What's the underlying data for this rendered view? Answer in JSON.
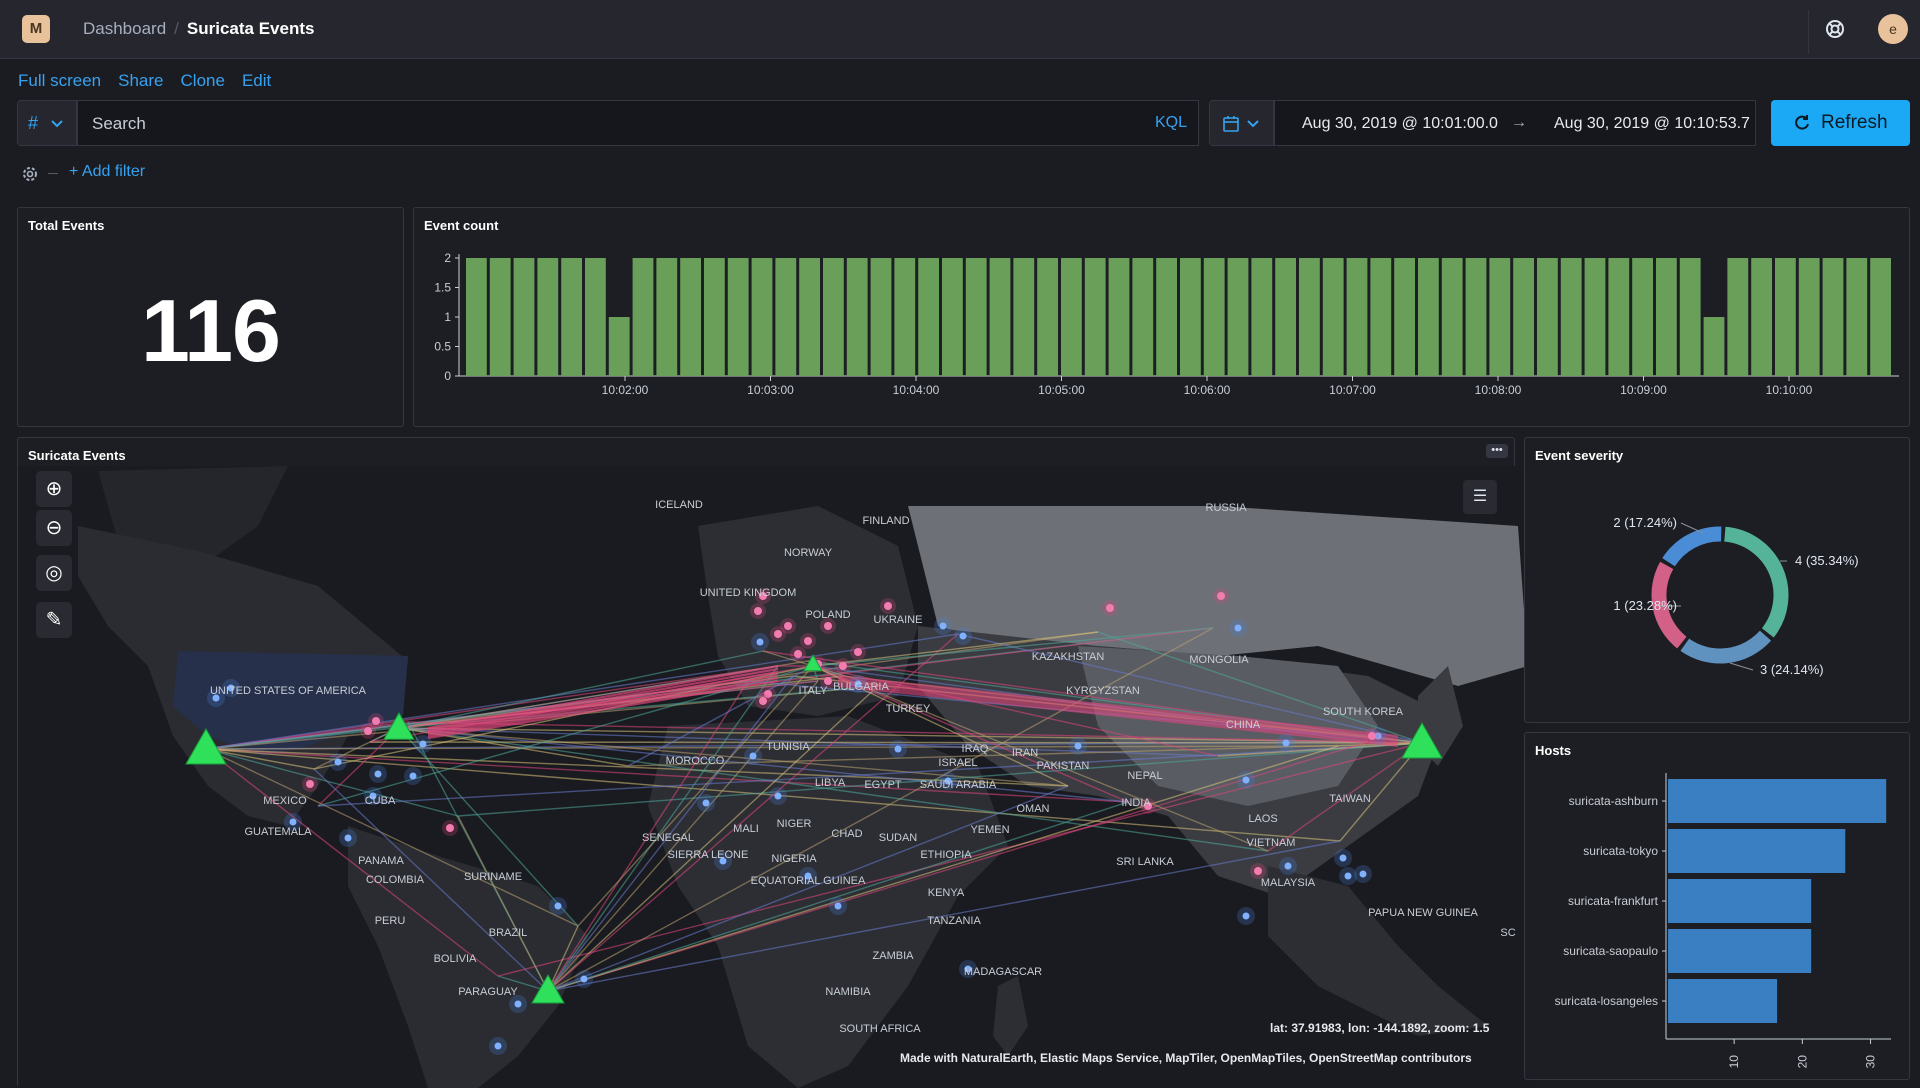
{
  "app": {
    "logo_letter": "M",
    "breadcrumbs": [
      "Dashboard",
      "Suricata Events"
    ],
    "user_initial": "e"
  },
  "actions": [
    "Full screen",
    "Share",
    "Clone",
    "Edit"
  ],
  "query": {
    "lang_symbol": "#",
    "placeholder": "Search",
    "language": "KQL",
    "time_start": "Aug 30, 2019 @ 10:01:00.0",
    "time_arrow": "→",
    "time_end": "Aug 30, 2019 @ 10:10:53.7",
    "refresh_label": "Refresh"
  },
  "filters": {
    "add_label": "+ Add filter"
  },
  "panels": {
    "total_events": {
      "title": "Total Events",
      "value": "116"
    },
    "event_count": {
      "title": "Event count"
    },
    "map": {
      "title": "Suricata Events",
      "coords": "lat: 37.91983, lon: -144.1892, zoom: 1.5",
      "attribution": "Made with NaturalEarth, Elastic Maps Service, MapTiler, OpenMapTiles, OpenStreetMap contributors",
      "labels": [
        "ICELAND",
        "FINLAND",
        "RUSSIA",
        "NORWAY",
        "UNITED KINGDOM",
        "POLAND",
        "UKRAINE",
        "KAZAKHSTAN",
        "MONGOLIA",
        "UNITED STATES OF AMERICA",
        "ITALY",
        "BULGARIA",
        "TURKEY",
        "KYRGYZSTAN",
        "SOUTH KOREA",
        "CHINA",
        "TUNISIA",
        "IRAQ",
        "IRAN",
        "MOROCCO",
        "ISRAEL",
        "PAKISTAN",
        "NEPAL",
        "LIBYA",
        "EGYPT",
        "SAUDI ARABIA",
        "TAIWAN",
        "MEXICO",
        "CUBA",
        "OMAN",
        "INDIA",
        "LAOS",
        "GUATEMALA",
        "SENEGAL",
        "MALI",
        "NIGER",
        "CHAD",
        "SUDAN",
        "YEMEN",
        "VIETNAM",
        "PANAMA",
        "SIERRA LEONE",
        "NIGERIA",
        "ETHIOPIA",
        "SRI LANKA",
        "COLOMBIA",
        "SURINAME",
        "EQUATORIAL GUINEA",
        "MALAYSIA",
        "KENYA",
        "PAPUA NEW GUINEA",
        "PERU",
        "BRAZIL",
        "TANZANIA",
        "BOLIVIA",
        "ZAMBIA",
        "MADAGASCAR",
        "PARAGUAY",
        "NAMIBIA",
        "SOUTH AFRICA",
        "SC"
      ]
    },
    "severity": {
      "title": "Event severity"
    },
    "hosts": {
      "title": "Hosts"
    }
  },
  "chart_data": [
    {
      "type": "bar",
      "title": "Event count",
      "x_ticks": [
        "10:02:00",
        "10:03:00",
        "10:04:00",
        "10:05:00",
        "10:06:00",
        "10:07:00",
        "10:08:00",
        "10:09:00",
        "10:10:00"
      ],
      "y_ticks": [
        "0",
        "0.5",
        "1",
        "1.5",
        "2"
      ],
      "ylim": [
        0,
        2
      ],
      "values": [
        2,
        2,
        2,
        2,
        2,
        2,
        1,
        2,
        2,
        2,
        2,
        2,
        2,
        2,
        2,
        2,
        2,
        2,
        2,
        2,
        2,
        2,
        2,
        2,
        2,
        2,
        2,
        2,
        2,
        2,
        2,
        2,
        2,
        2,
        2,
        2,
        2,
        2,
        2,
        2,
        2,
        2,
        2,
        2,
        2,
        2,
        2,
        2,
        2,
        2,
        2,
        2,
        1,
        2,
        2,
        2,
        2,
        2,
        2,
        2
      ],
      "color": "#6a9f5a"
    },
    {
      "type": "pie",
      "title": "Event severity",
      "slices": [
        {
          "label": "4 (35.34%)",
          "value": 35.34,
          "color": "#54b399"
        },
        {
          "label": "3 (24.14%)",
          "value": 24.14,
          "color": "#6092c0"
        },
        {
          "label": "1 (23.28%)",
          "value": 23.28,
          "color": "#d36086"
        },
        {
          "label": "2 (17.24%)",
          "value": 17.24,
          "color": "#4a8cd6"
        }
      ]
    },
    {
      "type": "bar",
      "orientation": "horizontal",
      "title": "Hosts",
      "categories": [
        "suricata-ashburn",
        "suricata-tokyo",
        "suricata-frankfurt",
        "suricata-saopaulo",
        "suricata-losangeles"
      ],
      "values": [
        32,
        26,
        21,
        21,
        16
      ],
      "x_ticks": [
        "10",
        "20",
        "30"
      ],
      "xlim": [
        0,
        33
      ],
      "color": "#3a7fc1"
    }
  ]
}
